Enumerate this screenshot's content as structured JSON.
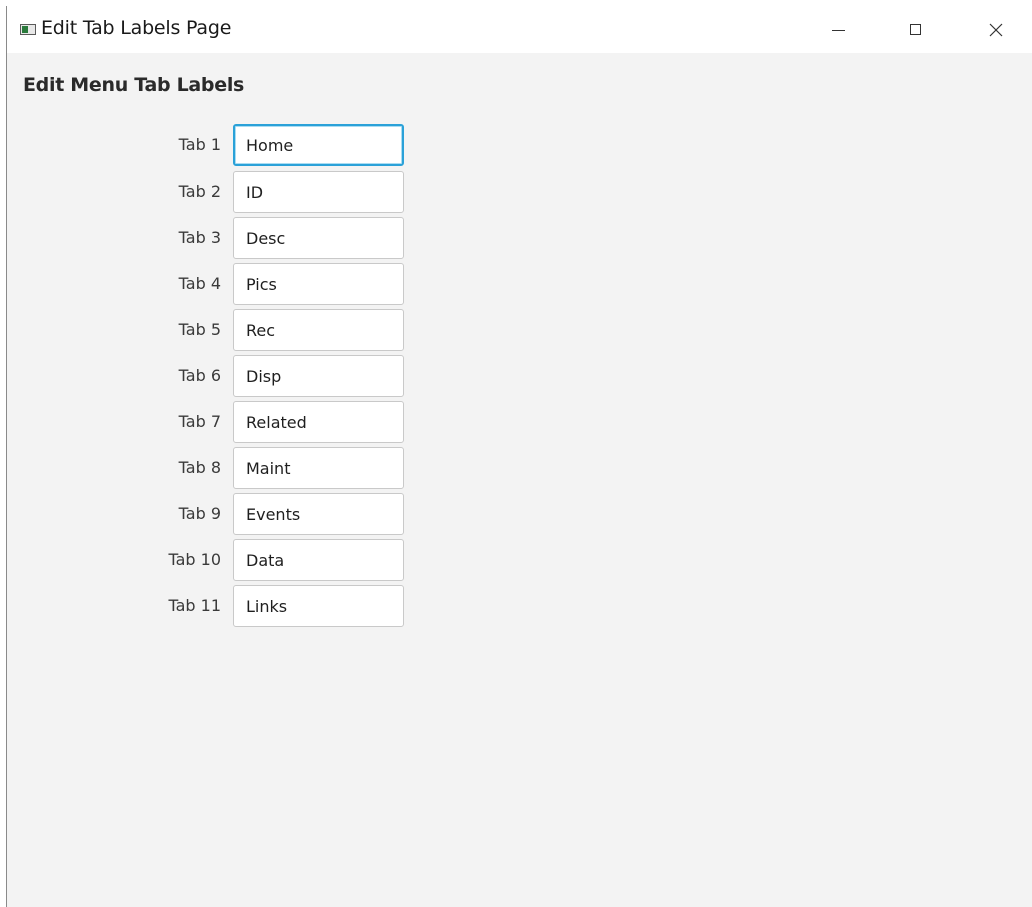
{
  "window": {
    "title": "Edit Tab Labels Page",
    "icon": "app-window-icon",
    "controls": {
      "minimize_icon": "minimize-icon",
      "maximize_icon": "maximize-icon",
      "close_icon": "close-icon",
      "close_glyph": "✕"
    }
  },
  "main": {
    "heading": "Edit Menu Tab Labels",
    "focused_index": 0,
    "focus_color": "#2aa1d8",
    "tabs": [
      {
        "label": "Tab 1",
        "value": "Home"
      },
      {
        "label": "Tab 2",
        "value": "ID"
      },
      {
        "label": "Tab 3",
        "value": "Desc"
      },
      {
        "label": "Tab 4",
        "value": "Pics"
      },
      {
        "label": "Tab 5",
        "value": "Rec"
      },
      {
        "label": "Tab 6",
        "value": "Disp"
      },
      {
        "label": "Tab 7",
        "value": "Related"
      },
      {
        "label": "Tab 8",
        "value": "Maint"
      },
      {
        "label": "Tab 9",
        "value": "Events"
      },
      {
        "label": "Tab 10",
        "value": "Data"
      },
      {
        "label": "Tab 11",
        "value": "Links"
      }
    ]
  }
}
